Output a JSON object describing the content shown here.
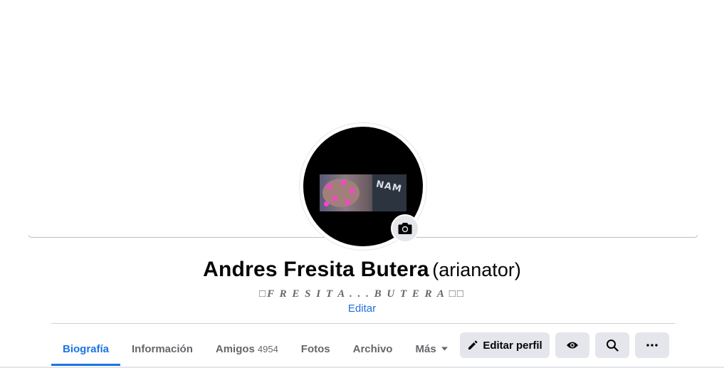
{
  "profile": {
    "name": "Andres Fresita Butera",
    "nickname": "(arianator)",
    "bio": "□F R E S I T A . . . B U T E R A □□",
    "edit_bio_label": "Editar",
    "avatar_shirt_text": "NAM"
  },
  "tabs": [
    {
      "label": "Biografía",
      "active": true
    },
    {
      "label": "Información"
    },
    {
      "label": "Amigos",
      "count": "4954"
    },
    {
      "label": "Fotos"
    },
    {
      "label": "Archivo"
    },
    {
      "label": "Más",
      "icon": "caret-down-icon"
    }
  ],
  "actions": {
    "edit_profile_label": "Editar perfil",
    "edit_profile_icon": "pencil-icon",
    "view_as_icon": "eye-icon",
    "search_icon": "search-icon",
    "more_icon": "ellipsis-icon",
    "camera_icon": "camera-icon"
  },
  "colors": {
    "accent": "#1b74e4",
    "link": "#216fdb",
    "button_bg": "#e4e6eb",
    "muted_text": "#65676b"
  }
}
